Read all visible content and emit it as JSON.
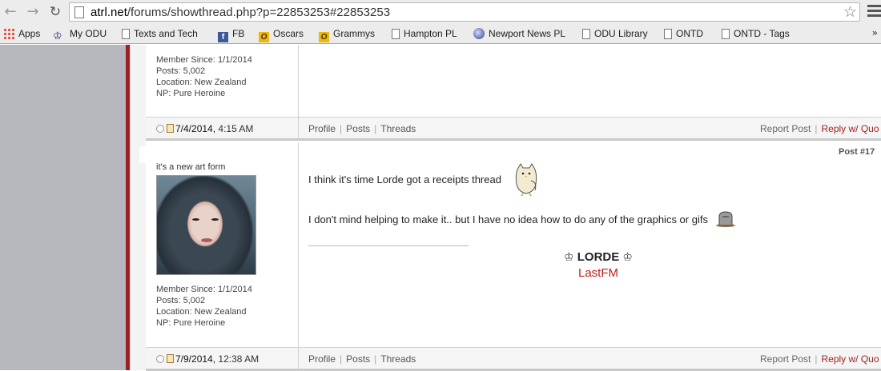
{
  "browser": {
    "url_domain": "atrl.net",
    "url_path": "/forums/showthread.php?p=22853253#22853253",
    "bookmarks": [
      {
        "label": "Apps",
        "icon": "apps-grid-icon"
      },
      {
        "label": "My ODU",
        "icon": "crown-icon"
      },
      {
        "label": "Texts and Tech",
        "icon": "page-icon"
      },
      {
        "label": "FB",
        "icon": "facebook-icon"
      },
      {
        "label": "Oscars",
        "icon": "o-icon"
      },
      {
        "label": "Grammys",
        "icon": "o-icon"
      },
      {
        "label": "Hampton PL",
        "icon": "page-icon"
      },
      {
        "label": "Newport News PL",
        "icon": "globe-icon"
      },
      {
        "label": "ODU Library",
        "icon": "page-icon"
      },
      {
        "label": "ONTD",
        "icon": "page-icon"
      },
      {
        "label": "ONTD - Tags",
        "icon": "page-icon"
      }
    ],
    "more": "»"
  },
  "post1": {
    "member_since": "Member Since: 1/1/2014",
    "posts": "Posts: 5,002",
    "location": "Location: New Zealand",
    "np": "NP: Pure Heroine",
    "date": "7/4/2014,",
    "time": "4:15 AM",
    "links": [
      "Profile",
      "Posts",
      "Threads"
    ],
    "report": "Report Post",
    "reply": "Reply w/ Quo"
  },
  "post2": {
    "user_title": "it's a new art form",
    "post_number": "Post #17",
    "message_line1": "I think it's time Lorde got a receipts thread",
    "message_line2": "I don't mind helping to make it.. but I have no idea how to do any of the graphics or gifs",
    "signature_name": "LORDE",
    "signature_link": "LastFM",
    "member_since": "Member Since: 1/1/2014",
    "posts": "Posts: 5,002",
    "location": "Location: New Zealand",
    "np": "NP: Pure Heroine",
    "date": "7/9/2014,",
    "time": "12:38 AM",
    "links": [
      "Profile",
      "Posts",
      "Threads"
    ],
    "report": "Report Post",
    "reply": "Reply w/ Quo"
  },
  "colors": {
    "accent_red": "#9e1f1f",
    "link_red": "#c41a1a"
  }
}
